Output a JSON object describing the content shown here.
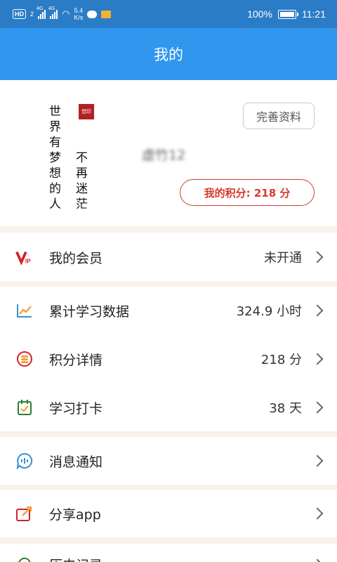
{
  "status_bar": {
    "hd": "HD",
    "sim": "2",
    "net1": "4G",
    "net2": "4G",
    "speed_value": "5.4",
    "speed_unit": "K/s",
    "battery_percent": "100%",
    "time": "11:21"
  },
  "header": {
    "title": "我的"
  },
  "profile": {
    "calligraphy_col1": "世界有梦想的人",
    "calligraphy_col2": "不再迷茫",
    "seal_text": "觉印",
    "username": "虚竹12",
    "edit_label": "完善资料",
    "points_label": "我的积分: 218 分"
  },
  "menu": {
    "vip": {
      "label": "我的会员",
      "value": "未开通",
      "icon": "vip-icon"
    },
    "study_data": {
      "label": "累计学习数据",
      "value": "324.9 小时",
      "icon": "chart-icon"
    },
    "points_detail": {
      "label": "积分详情",
      "value": "218 分",
      "icon": "coin-icon"
    },
    "checkin": {
      "label": "学习打卡",
      "value": "38 天",
      "icon": "calendar-check-icon"
    },
    "notifications": {
      "label": "消息通知",
      "value": "",
      "icon": "message-icon"
    },
    "share": {
      "label": "分享app",
      "value": "",
      "icon": "share-icon"
    },
    "history": {
      "label": "历史记录",
      "value": "",
      "icon": "history-icon"
    }
  },
  "colors": {
    "status_bar": "#2b7cc6",
    "title_bar": "#3096ee",
    "accent_red": "#d63b2c",
    "page_bg": "#f7f2ea"
  }
}
